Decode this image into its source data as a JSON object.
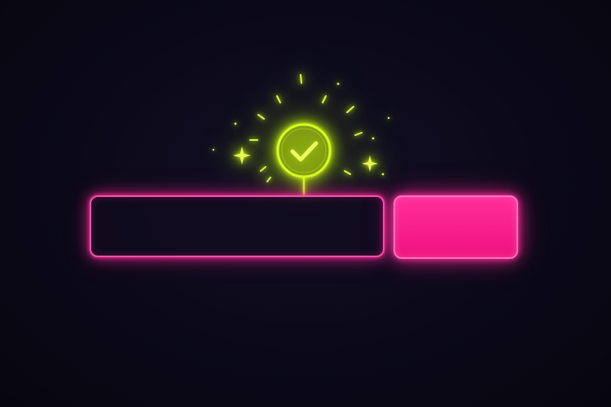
{
  "form": {
    "input_value": "",
    "submit_label": ""
  },
  "status": {
    "icon": "check-circle-icon",
    "state": "success"
  },
  "colors": {
    "background": "#0b0918",
    "accent_pink": "#ff2d9a",
    "accent_lime": "#d4ff1a"
  }
}
